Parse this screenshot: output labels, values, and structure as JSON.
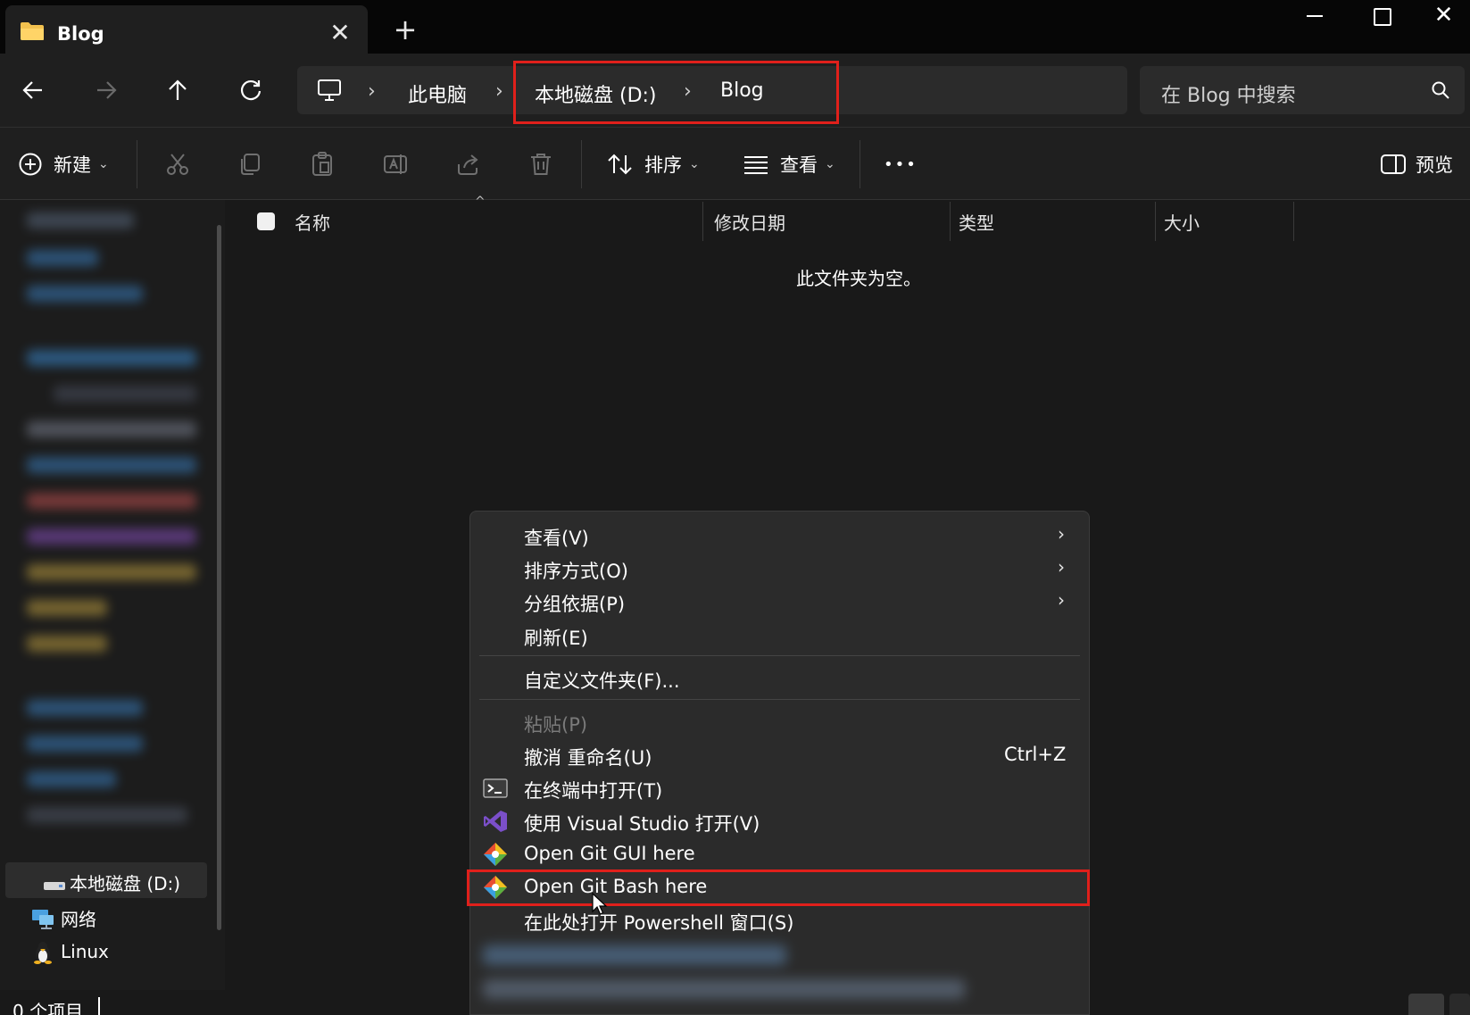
{
  "window": {
    "tab_title": "Blog",
    "tab_close": "✕",
    "new_tab": "+"
  },
  "address": {
    "crumbs": [
      "此电脑",
      "本地磁盘 (D:)",
      "Blog"
    ],
    "separator": "›",
    "search_placeholder": "在 Blog 中搜索"
  },
  "toolbar": {
    "new_label": "新建",
    "sort_label": "排序",
    "view_label": "查看",
    "more_label": "•••",
    "preview_label": "预览"
  },
  "sidebar": {
    "selected_drive": "本地磁盘 (D:)",
    "network": "网络",
    "linux": "Linux"
  },
  "columns": {
    "name": "名称",
    "modified": "修改日期",
    "type": "类型",
    "size": "大小"
  },
  "content": {
    "empty_message": "此文件夹为空。"
  },
  "status": {
    "item_count": "0 个项目"
  },
  "context_menu": {
    "items": [
      {
        "label": "查看(V)",
        "submenu": true
      },
      {
        "label": "排序方式(O)",
        "submenu": true
      },
      {
        "label": "分组依据(P)",
        "submenu": true
      },
      {
        "label": "刷新(E)"
      },
      {
        "label": "自定义文件夹(F)..."
      },
      {
        "label": "粘贴(P)",
        "disabled": true
      },
      {
        "label": "撤消 重命名(U)",
        "shortcut": "Ctrl+Z"
      },
      {
        "label": "在终端中打开(T)",
        "icon": "terminal-icon"
      },
      {
        "label": "使用 Visual Studio 打开(V)",
        "icon": "visual-studio-icon"
      },
      {
        "label": "Open Git GUI here",
        "icon": "git-icon"
      },
      {
        "label": "Open Git Bash here",
        "icon": "git-icon",
        "highlighted": true
      },
      {
        "label": "在此处打开 Powershell 窗口(S)"
      }
    ],
    "submenu_arrow": "›"
  },
  "colors": {
    "highlight": "#e0201b",
    "background": "#191919",
    "menu_background": "#2b2b2b"
  }
}
